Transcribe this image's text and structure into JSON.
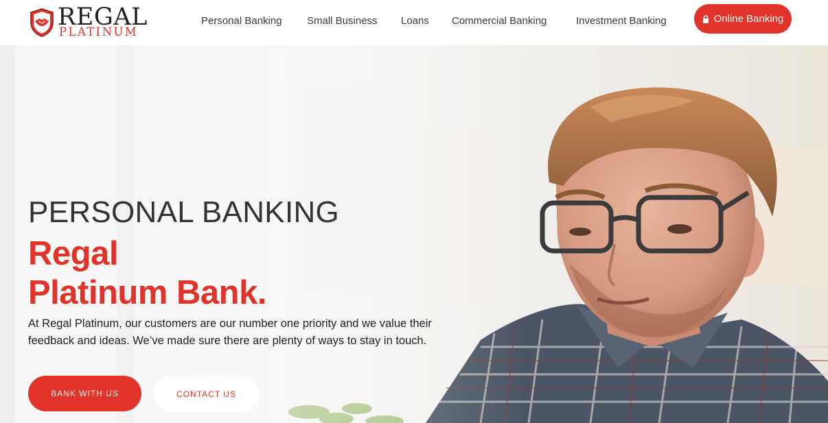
{
  "brand": {
    "name_top": "REGAL",
    "name_bottom": "PLATINUM",
    "logo_icon": "handshake-shield-icon",
    "accent_color": "#e2332b"
  },
  "nav": {
    "items": [
      {
        "label": "Personal Banking"
      },
      {
        "label": "Small Business"
      },
      {
        "label": "Loans"
      },
      {
        "label": "Commercial Banking"
      },
      {
        "label": "Investment Banking"
      }
    ],
    "online_banking": {
      "label": "Online Banking",
      "icon": "lock-icon"
    }
  },
  "hero": {
    "eyebrow": "PERSONAL BANKING",
    "title_line1": "Regal",
    "title_line2": "Platinum Bank.",
    "description": "At Regal Platinum, our customers are our number one priority and we value their feedback and ideas. We’ve made sure there are plenty of ways to stay in touch.",
    "primary_button": "BANK WITH US",
    "secondary_button": "CONTACT US",
    "image": "man-with-glasses-photo"
  }
}
